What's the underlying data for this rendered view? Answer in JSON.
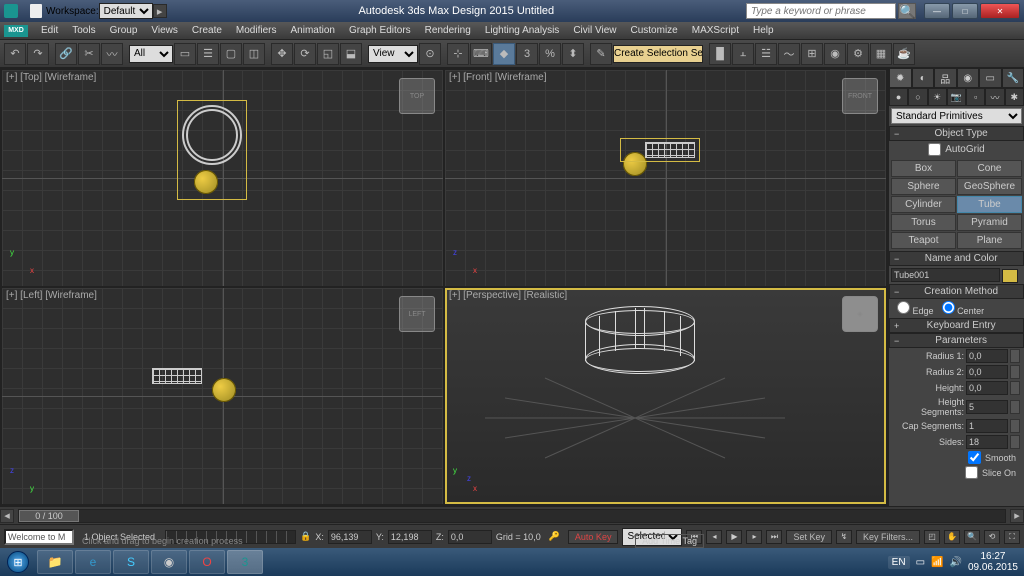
{
  "window": {
    "workspace_label": "Workspace:",
    "workspace_value": "Default",
    "title": "Autodesk 3ds Max Design 2015   Untitled",
    "search_placeholder": "Type a keyword or phrase",
    "mxd": "MXD"
  },
  "menu": [
    "Edit",
    "Tools",
    "Group",
    "Views",
    "Create",
    "Modifiers",
    "Animation",
    "Graph Editors",
    "Rendering",
    "Lighting Analysis",
    "Civil View",
    "Customize",
    "MAXScript",
    "Help"
  ],
  "toolbar": {
    "filter_all": "All",
    "view_label": "View",
    "create_sel_set": "Create Selection Se"
  },
  "viewports": {
    "top": "[+] [Top] [Wireframe]",
    "front": "[+] [Front] [Wireframe]",
    "left": "[+] [Left] [Wireframe]",
    "persp": "[+] [Perspective] [Realistic]"
  },
  "panel": {
    "category": "Standard Primitives",
    "rollout_objtype": "Object Type",
    "autogrid": "AutoGrid",
    "primitives": [
      [
        "Box",
        "Cone"
      ],
      [
        "Sphere",
        "GeoSphere"
      ],
      [
        "Cylinder",
        "Tube"
      ],
      [
        "Torus",
        "Pyramid"
      ],
      [
        "Teapot",
        "Plane"
      ]
    ],
    "rollout_name": "Name and Color",
    "object_name": "Tube001",
    "rollout_creation": "Creation Method",
    "edge": "Edge",
    "center": "Center",
    "rollout_keyboard": "Keyboard Entry",
    "rollout_params": "Parameters",
    "params": {
      "radius1_label": "Radius 1:",
      "radius1": "0,0",
      "radius2_label": "Radius 2:",
      "radius2": "0,0",
      "height_label": "Height:",
      "height": "0,0",
      "hseg_label": "Height Segments:",
      "hseg": "5",
      "cseg_label": "Cap Segments:",
      "cseg": "1",
      "sides_label": "Sides:",
      "sides": "18",
      "smooth": "Smooth",
      "slice": "Slice On"
    }
  },
  "timeline": {
    "frame": "0 / 100"
  },
  "status": {
    "welcome": "Welcome to M",
    "sel_count": "1 Object Selected",
    "x": "96,139",
    "y": "12,198",
    "z": "0,0",
    "grid": "Grid = 10,0",
    "autokey": "Auto Key",
    "setkey": "Set Key",
    "selected": "Selected",
    "keyfilters": "Key Filters...",
    "prompt": "Click and drag to begin creation process",
    "add_time_tag": "Add Time Tag"
  },
  "coord_labels": {
    "x": "X:",
    "y": "Y:",
    "z": "Z:"
  },
  "taskbar": {
    "lang": "EN",
    "time": "16:27",
    "date": "09.06.2015"
  }
}
